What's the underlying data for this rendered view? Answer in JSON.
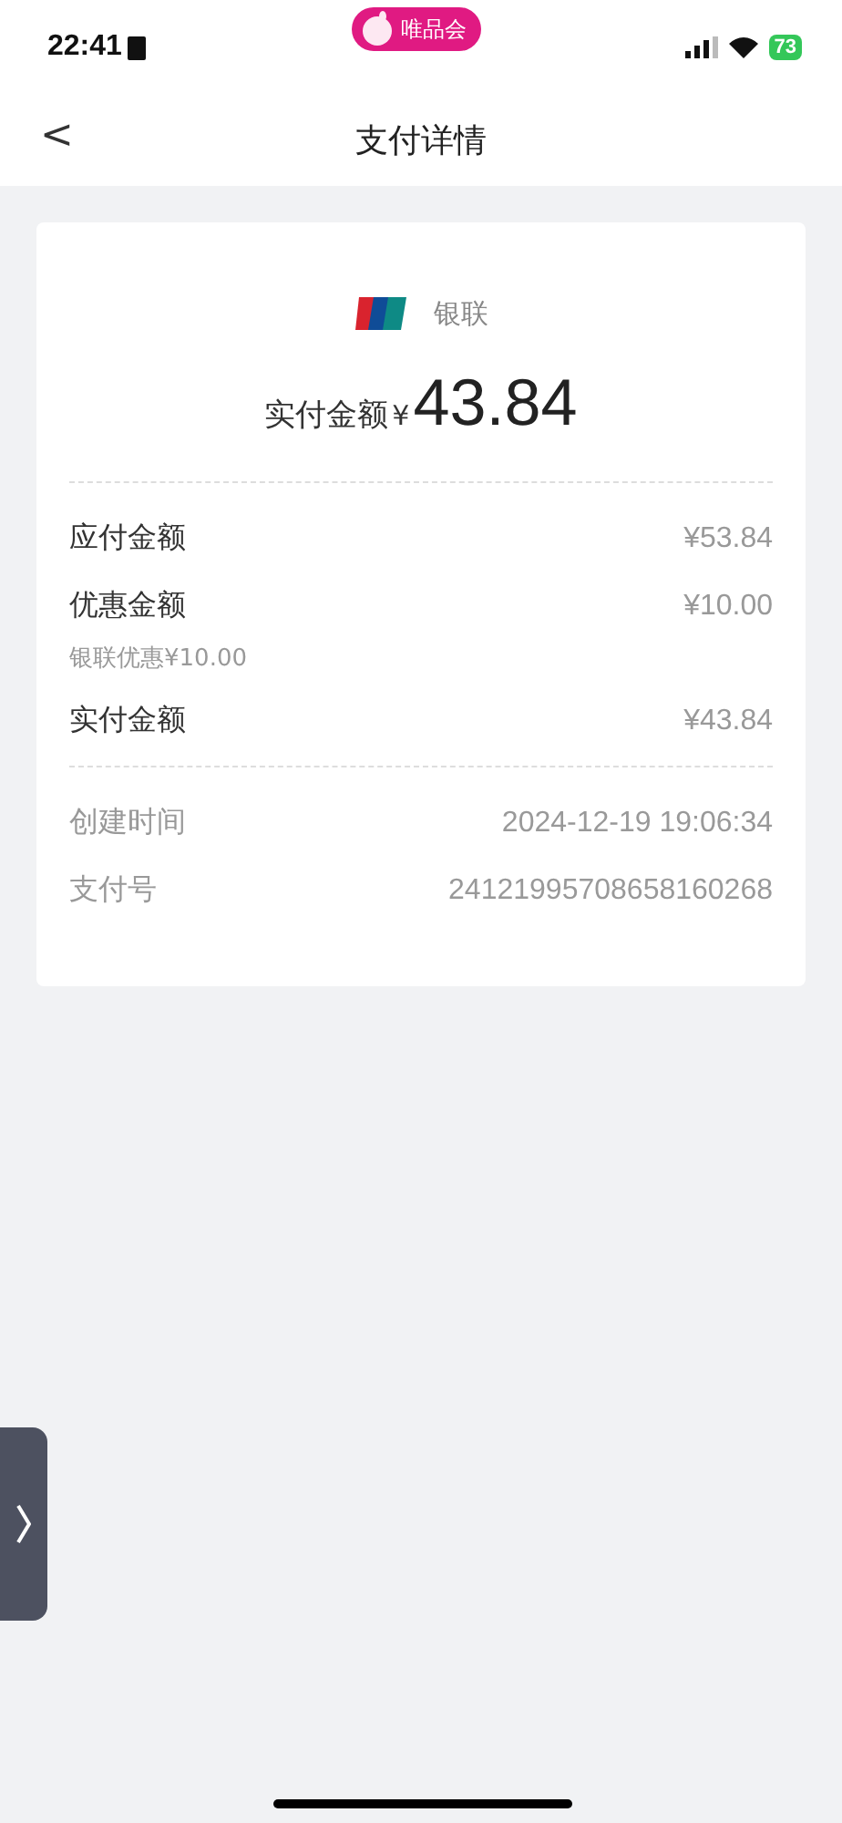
{
  "status_bar": {
    "time": "22:41",
    "app_badge": "唯品会",
    "battery": "73"
  },
  "nav": {
    "title": "支付详情",
    "back": "<"
  },
  "payment": {
    "method": "银联",
    "amount_label": "实付金额",
    "currency": "¥",
    "amount": "43.84"
  },
  "sections": [
    {
      "rows": [
        {
          "kind": "primary",
          "label": "应付金额",
          "value": "¥53.84"
        },
        {
          "kind": "primary",
          "label": "优惠金额",
          "value": "¥10.00"
        },
        {
          "kind": "note",
          "text": "银联优惠¥10.00"
        },
        {
          "kind": "primary",
          "label": "实付金额",
          "value": "¥43.84"
        }
      ]
    },
    {
      "rows": [
        {
          "kind": "secondary",
          "label": "创建时间",
          "value": "2024-12-19 19:06:34"
        },
        {
          "kind": "secondary",
          "label": "支付号",
          "value": "24121995708658160268"
        }
      ]
    }
  ]
}
